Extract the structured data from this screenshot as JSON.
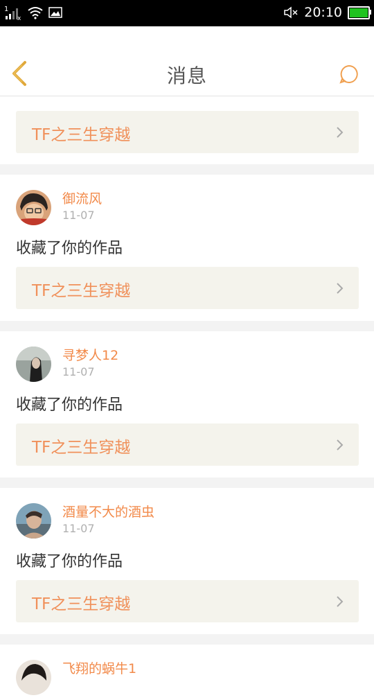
{
  "status_bar": {
    "time": "20:10",
    "signal_icon": "signal-icon",
    "wifi_icon": "wifi-icon",
    "image_icon": "image-icon",
    "mute_icon": "mute-icon",
    "battery_icon": "battery-icon",
    "battery_color": "#1fc31f"
  },
  "header": {
    "title": "消息",
    "back_icon": "chevron-left-icon",
    "chat_icon": "chat-bubble-icon",
    "accent_color": "#f0a050"
  },
  "first_card": {
    "work_title": "TF之三生穿越"
  },
  "messages": [
    {
      "user": "御流风",
      "date": "11-07",
      "action": "收藏了你的作品",
      "work_title": "TF之三生穿越"
    },
    {
      "user": "寻梦人12",
      "date": "11-07",
      "action": "收藏了你的作品",
      "work_title": "TF之三生穿越"
    },
    {
      "user": "酒量不大的酒虫",
      "date": "11-07",
      "action": "收藏了你的作品",
      "work_title": "TF之三生穿越"
    }
  ],
  "partial_card": {
    "user": "飞翔的蜗牛1"
  },
  "colors": {
    "username": "#f28a4a",
    "work_title": "#f0905a",
    "work_bg": "#f4f3ec",
    "date": "#b0b0b0"
  }
}
